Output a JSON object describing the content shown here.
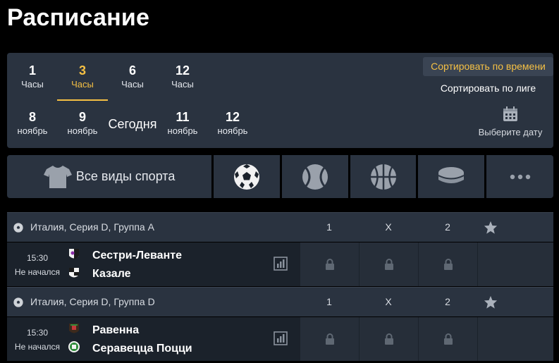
{
  "page": {
    "title": "Расписание"
  },
  "time_filters": [
    {
      "num": "1",
      "unit": "Часы",
      "active": false
    },
    {
      "num": "3",
      "unit": "Часы",
      "active": true
    },
    {
      "num": "6",
      "unit": "Часы",
      "active": false
    },
    {
      "num": "12",
      "unit": "Часы",
      "active": false
    }
  ],
  "day_filters": [
    {
      "num": "8",
      "unit": "ноябрь"
    },
    {
      "num": "9",
      "unit": "ноябрь"
    },
    {
      "today": "Сегодня"
    },
    {
      "num": "11",
      "unit": "ноябрь"
    },
    {
      "num": "12",
      "unit": "ноябрь"
    }
  ],
  "sort": {
    "by_time": "Сортировать по времени",
    "by_league": "Сортировать по лиге",
    "pick_date": "Выберите дату"
  },
  "sports": {
    "all_label": "Все виды спорта",
    "icons": [
      "soccer-ball-icon",
      "tennis-ball-icon",
      "basketball-icon",
      "hockey-puck-icon",
      "more-dots-icon"
    ]
  },
  "columns": {
    "c1": "1",
    "cx": "X",
    "c2": "2"
  },
  "leagues": [
    {
      "name": "Италия, Серия D, Группа A",
      "match": {
        "time": "15:30",
        "status": "Не начался",
        "home": "Сестри-Леванте",
        "away": "Казале"
      }
    },
    {
      "name": "Италия, Серия D, Группа D",
      "match": {
        "time": "15:30",
        "status": "Не начался",
        "home": "Равенна",
        "away": "Серавецца Поцци"
      }
    }
  ],
  "colors": {
    "accent": "#f5c044",
    "panel": "#2a3340",
    "row": "#1b222b",
    "cell": "#262e39"
  }
}
